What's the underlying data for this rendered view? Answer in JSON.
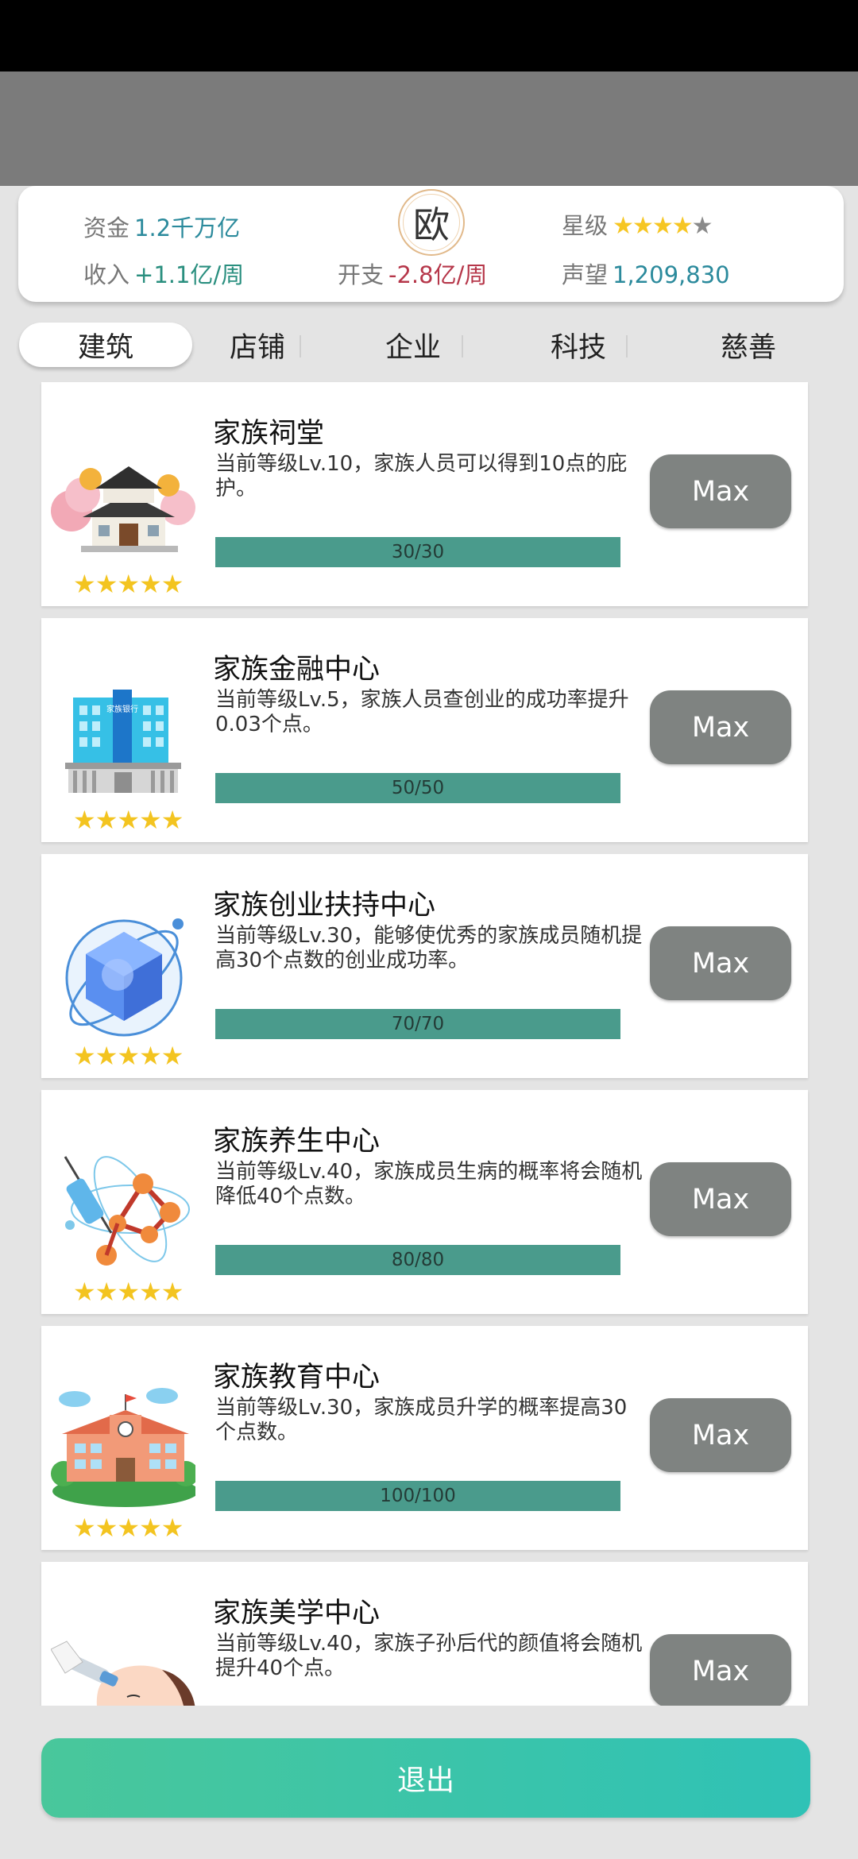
{
  "stats": {
    "funds_label": "资金",
    "funds_value": "1.2千万亿",
    "income_label": "收入",
    "income_value": "+1.1亿/周",
    "expense_label": "开支",
    "expense_value": "-2.8亿/周",
    "stars_label": "星级",
    "stars_filled": 4,
    "stars_total": 5,
    "prestige_label": "声望",
    "prestige_value": "1,209,830",
    "luck_badge": "欧"
  },
  "tabs": [
    {
      "label": "建筑",
      "active": true
    },
    {
      "label": "店铺",
      "active": false
    },
    {
      "label": "企业",
      "active": false
    },
    {
      "label": "科技",
      "active": false
    },
    {
      "label": "慈善",
      "active": false
    }
  ],
  "buildings": [
    {
      "title": "家族祠堂",
      "desc": "当前等级Lv.10，家族人员可以得到10点的庇护。",
      "progress": "30/30",
      "button": "Max",
      "stars": "★★★★★",
      "icon": "ancestral-hall-icon"
    },
    {
      "title": "家族金融中心",
      "desc": "当前等级Lv.5，家族人员查创业的成功率提升0.03个点。",
      "progress": "50/50",
      "button": "Max",
      "stars": "★★★★★",
      "icon": "bank-building-icon",
      "sign_text": "家族银行"
    },
    {
      "title": "家族创业扶持中心",
      "desc": "当前等级Lv.30，能够使优秀的家族成员随机提高30个点数的创业成功率。",
      "progress": "70/70",
      "button": "Max",
      "stars": "★★★★★",
      "icon": "crystal-orb-icon"
    },
    {
      "title": "家族养生中心",
      "desc": "当前等级Lv.40，家族成员生病的概率将会随机降低40个点数。",
      "progress": "80/80",
      "button": "Max",
      "stars": "★★★★★",
      "icon": "syringe-molecule-icon"
    },
    {
      "title": "家族教育中心",
      "desc": "当前等级Lv.30，家族成员升学的概率提高30个点数。",
      "progress": "100/100",
      "button": "Max",
      "stars": "★★★★★",
      "icon": "school-building-icon"
    },
    {
      "title": "家族美学中心",
      "desc": "当前等级Lv.40，家族子孙后代的颜值将会随机提升40个点。",
      "progress": "",
      "button": "Max",
      "stars": "",
      "icon": "beauty-treatment-icon"
    }
  ],
  "exit_label": "退出",
  "colors": {
    "accent": "#4a9b8c",
    "exit_start": "#49c79b",
    "exit_end": "#2fc2b6",
    "max_button": "#7f8381"
  }
}
